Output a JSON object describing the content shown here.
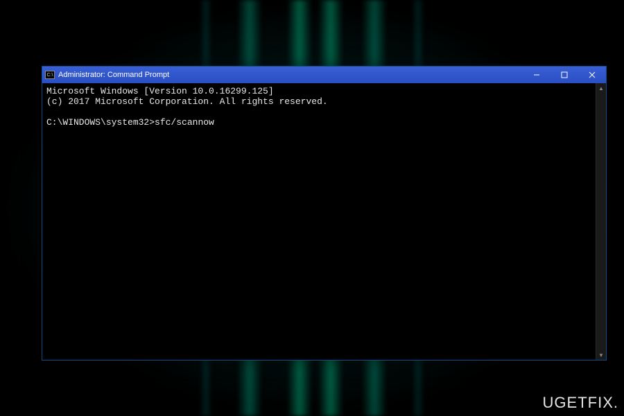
{
  "window": {
    "title": "Administrator: Command Prompt",
    "icon_glyph": "C:\\"
  },
  "terminal": {
    "line1": "Microsoft Windows [Version 10.0.16299.125]",
    "line2": "(c) 2017 Microsoft Corporation. All rights reserved.",
    "blank": "",
    "prompt": "C:\\WINDOWS\\system32>",
    "command": "sfc/scannow"
  },
  "watermark": {
    "text": "UGETFIX."
  },
  "colors": {
    "titlebar": "#2a4fc4",
    "terminal_bg": "#000000",
    "terminal_fg": "#e8e8e8"
  }
}
